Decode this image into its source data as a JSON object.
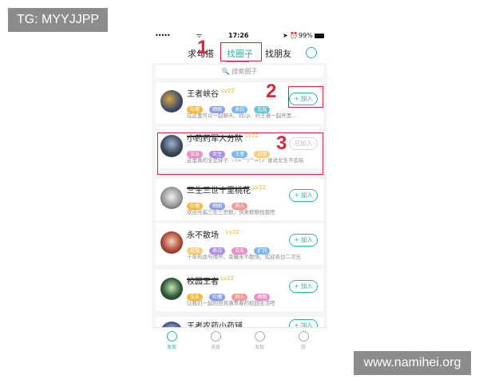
{
  "watermarks": {
    "top_left": "TG: MYYJJPP",
    "bottom_right": "www.namihei.org"
  },
  "status_bar": {
    "signal": "•••••",
    "wifi": "ᯤ",
    "time": "17:26",
    "icons": "➤ ⏰",
    "battery": "99%"
  },
  "nav": {
    "tabs": [
      "求勾搭",
      "找圈子",
      "找朋友"
    ],
    "active_tab": 1
  },
  "search": {
    "placeholder": "🔍 搜索圈子"
  },
  "annotations": [
    "1",
    "2",
    "3"
  ],
  "circles": [
    {
      "name": "王者峡谷",
      "level": "Lv22",
      "tags": [
        "吐槽",
        "晒图",
        "表白",
        "交友"
      ],
      "desc": "在这里可以一起聊天、找cp、约王者一起开黑...",
      "join": "+ 加入",
      "redacted": false
    },
    {
      "name": "小药药军人分队",
      "level": "Lv22",
      "tags": [
        "交友",
        "女生",
        "王者",
        "日常"
      ],
      "desc": "这里真的全是妹子 ヽ(=^▽^=)ノ 谁说女生不会玩",
      "join": "已加入",
      "redacted": true
    },
    {
      "name": "三生三世十里桃花",
      "level": "Lv22",
      "tags": [
        "吐槽",
        "晒图",
        "同人"
      ],
      "desc": "欢迎光临三生三世群，快来群聊找我吧",
      "join": "+ 加入",
      "redacted": true
    },
    {
      "name": "永不散场",
      "level": "Lv22",
      "tags": [
        "日常",
        "表白",
        "交友",
        "扩列"
      ],
      "desc": "十年热血与情怀，荣耀永不散场，欢迎各位二次元",
      "join": "+ 加入",
      "redacted": false
    },
    {
      "name": "校园王者",
      "level": "Lv22",
      "tags": [
        "交友",
        "吐槽",
        "同人",
        "晒图"
      ],
      "desc": "让我们一起回到充满青春的校园生活吧",
      "join": "+ 加入",
      "redacted": true
    },
    {
      "name": "王者农药小药铺",
      "level": "",
      "tags": [],
      "desc": "",
      "join": "+ 加入",
      "redacted": false
    }
  ],
  "bottom_tabs": [
    "发现",
    "消息",
    "发现",
    "我"
  ],
  "colors": {
    "accent": "#2bb5a6",
    "annotation": "#d6283a"
  }
}
